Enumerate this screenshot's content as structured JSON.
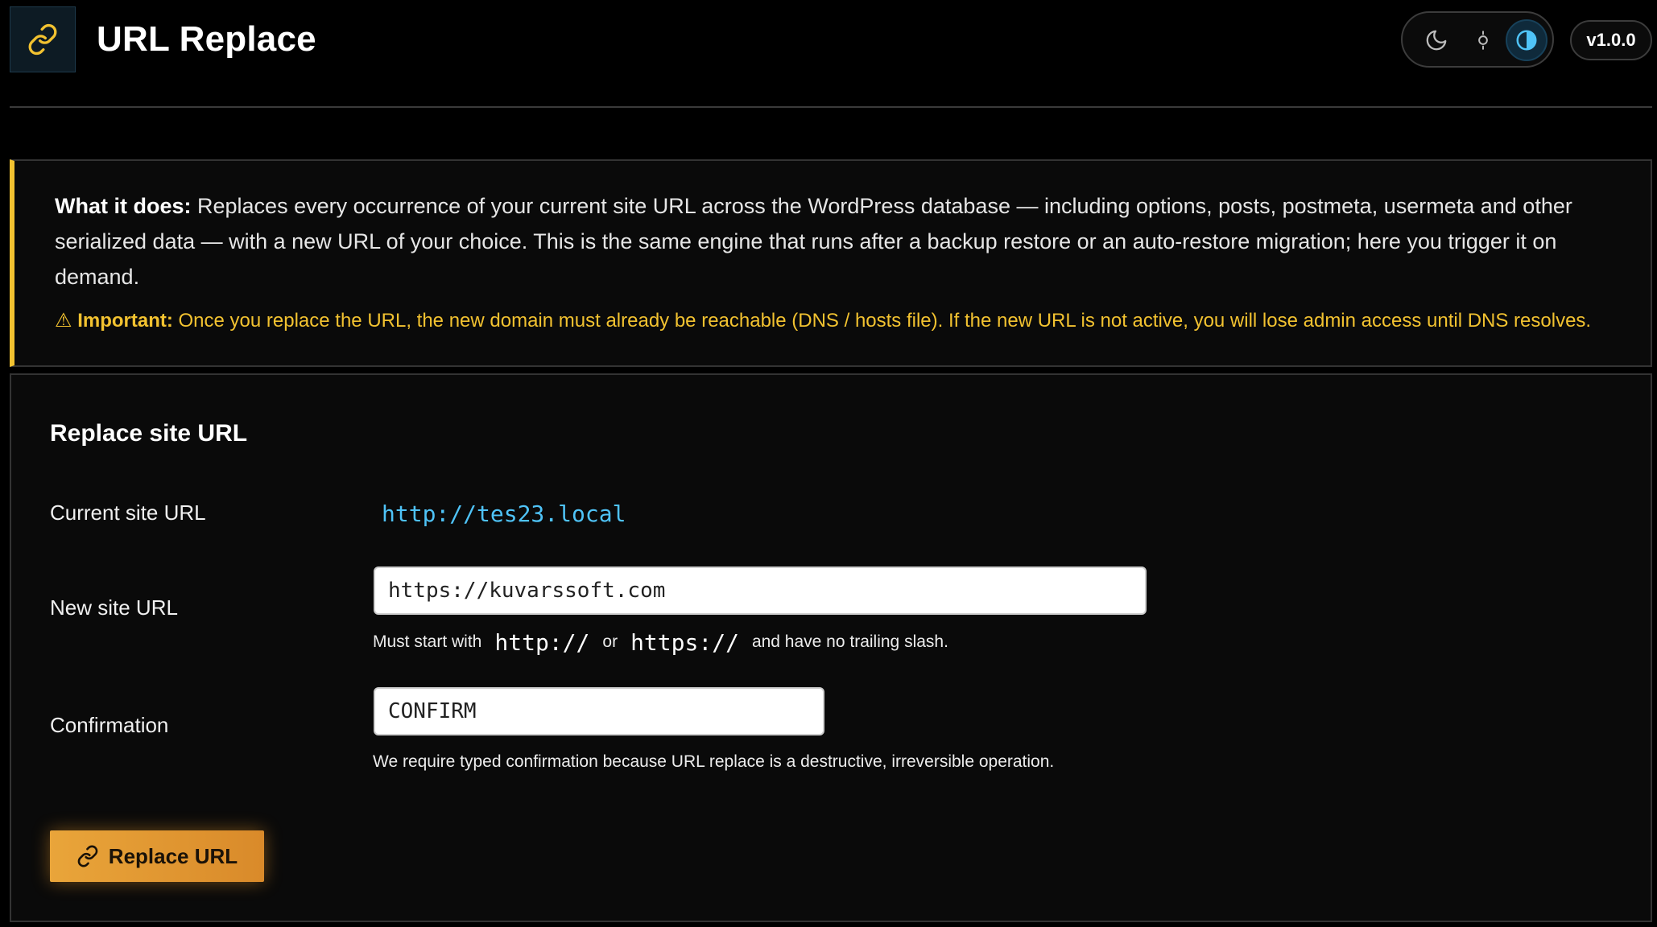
{
  "header": {
    "title": "URL Replace",
    "version": "v1.0.0",
    "logo_icon": "link-icon",
    "theme_options": [
      "moon-icon",
      "sun-icon",
      "contrast-icon"
    ],
    "active_theme": "contrast-icon"
  },
  "notice": {
    "what_label": "What it does:",
    "what_text": " Replaces every occurrence of your current site URL across the WordPress database — including options, posts, postmeta, usermeta and other serialized data — with a new URL of your choice. This is the same engine that runs after a backup restore or an auto-restore migration; here you trigger it on demand.",
    "important_symbol": "⚠",
    "important_label": "Important:",
    "important_text": " Once you replace the URL, the new domain must already be reachable (DNS / hosts file). If the new URL is not active, you will lose admin access until DNS resolves.",
    "accent_color": "#f2c230"
  },
  "form": {
    "title": "Replace site URL",
    "current_label": "Current site URL",
    "current_value": "http://tes23.local",
    "new_label": "New site URL",
    "new_value": "https://kuvarssoft.com",
    "new_hint_prefix": "Must start with",
    "new_hint_code1": "http://",
    "new_hint_or": "or",
    "new_hint_code2": "https://",
    "new_hint_suffix": "and have no trailing slash.",
    "confirm_label": "Confirmation",
    "confirm_value": "CONFIRM",
    "confirm_hint": "We require typed confirmation because URL replace is a destructive, irreversible operation.",
    "submit_label": "Replace URL"
  }
}
